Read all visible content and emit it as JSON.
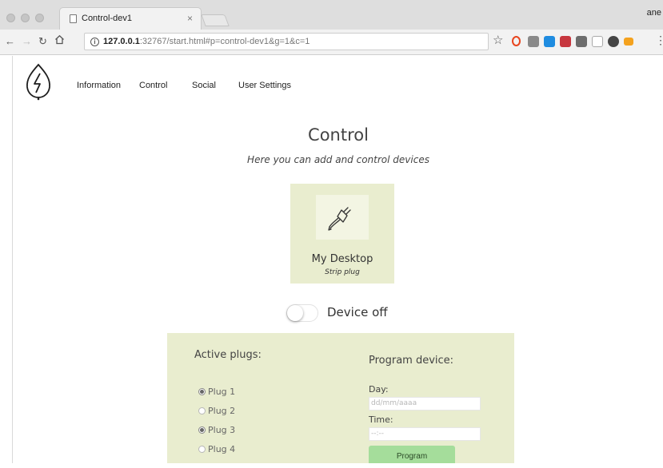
{
  "browser": {
    "tab_title": "Control-dev1",
    "tab_close": "×",
    "profile_name": "ane",
    "url_host": "127.0.0.1",
    "url_rest": ":32767/start.html#p=control-dev1&g=1&c=1",
    "extension_colors": [
      "#e8461f",
      "#8a8a8a",
      "#1f8ce0",
      "#c7373f",
      "#6d6d6d",
      "#b0b0b0",
      "#454545",
      "#f4a21e"
    ]
  },
  "nav": {
    "items": [
      "Information",
      "Control",
      "Social",
      "User Settings"
    ]
  },
  "main": {
    "title": "Control",
    "subtitle": "Here you can add and control devices"
  },
  "device": {
    "name": "My Desktop",
    "type": "Strip plug",
    "icon": "plug-icon"
  },
  "toggle": {
    "state": false,
    "label": "Device off"
  },
  "plugs": {
    "heading": "Active plugs:",
    "items": [
      {
        "label": "Plug 1",
        "active": true
      },
      {
        "label": "Plug 2",
        "active": false
      },
      {
        "label": "Plug 3",
        "active": true
      },
      {
        "label": "Plug 4",
        "active": false
      }
    ]
  },
  "program": {
    "heading": "Program device:",
    "day_label": "Day:",
    "day_placeholder": "dd/mm/aaaa",
    "time_label": "Time:",
    "time_placeholder": "--:--",
    "button_label": "Program"
  },
  "colors": {
    "card_bg": "#e9edcf",
    "program_button": "#a5dd9b"
  }
}
